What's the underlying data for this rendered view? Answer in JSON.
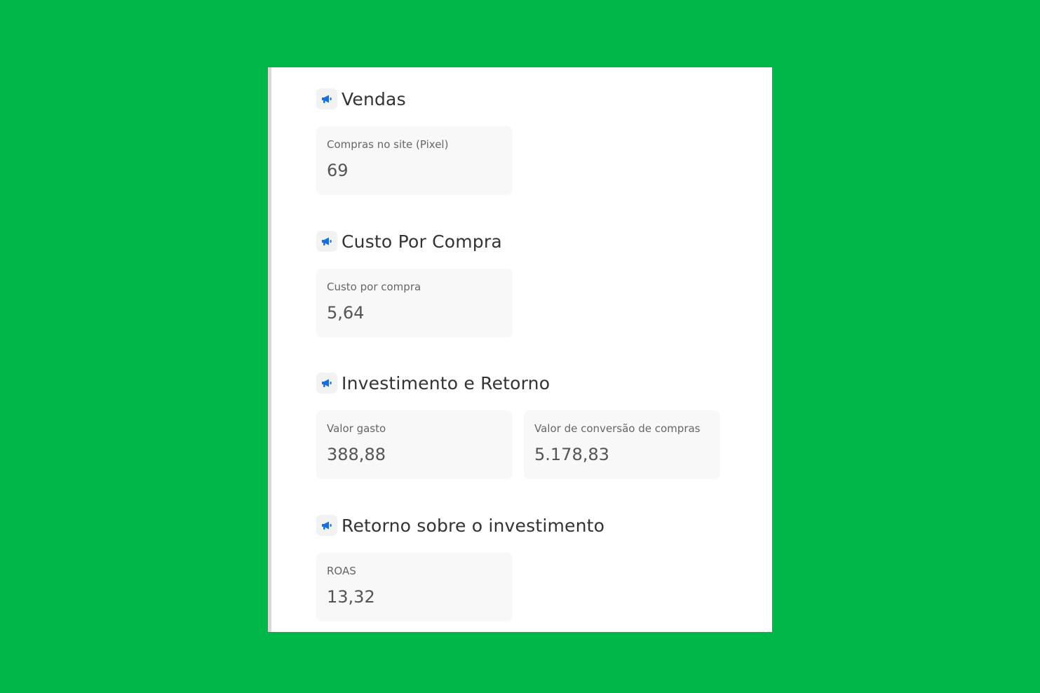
{
  "colors": {
    "background": "#00b84a",
    "panel": "#ffffff",
    "card": "#f8f8f8",
    "icon_accent": "#1a6fe0"
  },
  "sections": [
    {
      "title": "Vendas",
      "icon": "megaphone-icon",
      "cards": [
        {
          "label": "Compras no site (Pixel)",
          "value": "69"
        }
      ]
    },
    {
      "title": "Custo Por Compra",
      "icon": "megaphone-icon",
      "cards": [
        {
          "label": "Custo por compra",
          "value": "5,64"
        }
      ]
    },
    {
      "title": "Investimento e Retorno",
      "icon": "megaphone-icon",
      "cards": [
        {
          "label": "Valor gasto",
          "value": "388,88"
        },
        {
          "label": "Valor de conversão de compras",
          "value": "5.178,83"
        }
      ]
    },
    {
      "title": "Retorno sobre o investimento",
      "icon": "megaphone-icon",
      "cards": [
        {
          "label": "ROAS",
          "value": "13,32"
        }
      ]
    }
  ]
}
